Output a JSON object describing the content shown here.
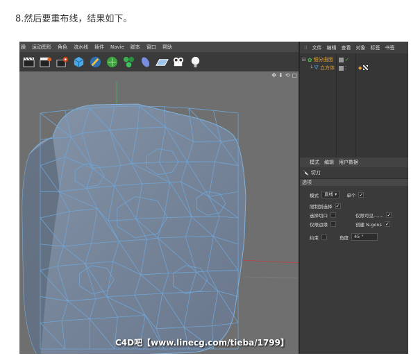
{
  "caption": "8.然后要重布线，结果如下。",
  "menu": [
    "躁",
    "运动图形",
    "角色",
    "流水线",
    "插件",
    "Navie",
    "脚本",
    "窗口",
    "帮助"
  ],
  "toolbar_icons": [
    "clapboard-icon",
    "clapboard-gear-icon",
    "render-settings-icon",
    "cube-icon",
    "pen-icon",
    "subdivision-icon",
    "cloner-icon",
    "deformer-icon",
    "floor-icon",
    "camera-icon",
    "light-icon"
  ],
  "viewport_icons": [
    "✥",
    "⬇",
    "⟲",
    "▢"
  ],
  "watermark": "C4D吧【www.linecg.com/tieba/1799】",
  "object_manager": {
    "tabs": [
      "文件",
      "编辑",
      "查看",
      "对象",
      "标签",
      "书签"
    ],
    "objects": [
      {
        "name": "细分曲面",
        "level": 0
      },
      {
        "name": "立方体",
        "level": 1
      }
    ]
  },
  "attributes": {
    "tabs": [
      "模式",
      "编辑",
      "用户数据"
    ],
    "tool_name": "切刀",
    "section": "选项",
    "mode_label": "模式",
    "mode_value": "直线",
    "single_label": "单个",
    "restrict_label": "限制到选择",
    "select_cut_label": "选择切口",
    "visible_only_label": "仅限可见.......",
    "isolate_edge_label": "仅限边缘",
    "create_ngons_label": "创建 N-gons",
    "constrain_label": "约束",
    "angle_label": "角度",
    "angle_value": "45 °"
  }
}
